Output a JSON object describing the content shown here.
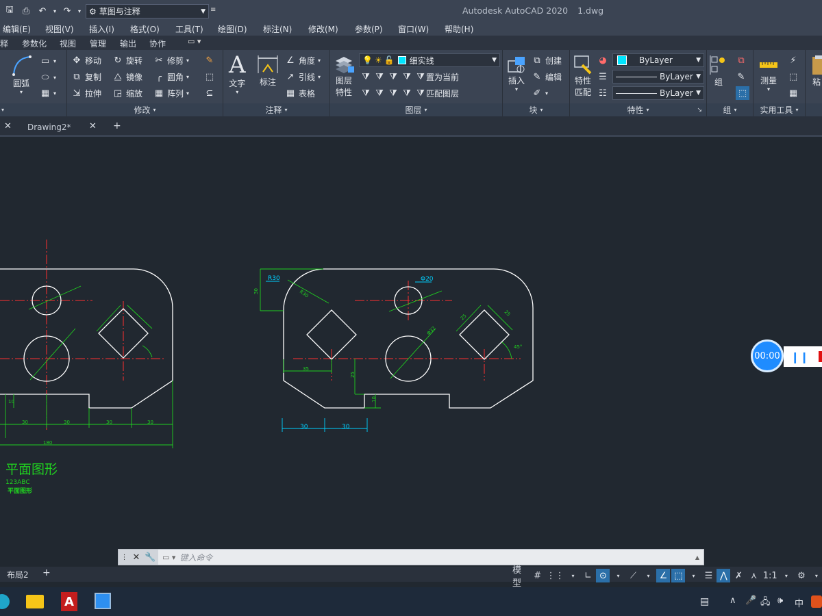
{
  "titlebar": {
    "workspace": "草图与注释",
    "app_title": "Autodesk AutoCAD 2020",
    "file_name": "1.dwg"
  },
  "menubar": {
    "items": [
      "编辑(E)",
      "视图(V)",
      "插入(I)",
      "格式(O)",
      "工具(T)",
      "绘图(D)",
      "标注(N)",
      "修改(M)",
      "参数(P)",
      "窗口(W)",
      "帮助(H)"
    ]
  },
  "ribbon_tabs": {
    "items": [
      "释",
      "参数化",
      "视图",
      "管理",
      "输出",
      "协作"
    ]
  },
  "ribbon": {
    "draw": {
      "arc": "圆弧"
    },
    "modify": {
      "title": "修改",
      "move": "移动",
      "rotate": "旋转",
      "trim": "修剪",
      "copy": "复制",
      "mirror": "镜像",
      "fillet": "圆角",
      "stretch": "拉伸",
      "scale": "缩放",
      "array": "阵列"
    },
    "annotation": {
      "title": "注释",
      "text": "文字",
      "dimension": "标注",
      "angular": "角度",
      "leader": "引线",
      "table": "表格"
    },
    "layers": {
      "title": "图层",
      "properties": "图层",
      "properties2": "特性",
      "current_layer": "细实线",
      "set_current": "置为当前",
      "match_layer": "匹配图层",
      "layer_color": "#00e5ff"
    },
    "block": {
      "title": "块",
      "insert": "插入",
      "create": "创建",
      "edit": "编辑"
    },
    "properties": {
      "title": "特性",
      "match": "特性",
      "match2": "匹配",
      "color": "ByLayer",
      "linetype": "ByLayer",
      "lineweight": "ByLayer"
    },
    "groups": {
      "title": "组",
      "group": "组"
    },
    "utilities": {
      "title": "实用工具",
      "measure": "测量"
    },
    "clipboard": {
      "paste": "粘"
    }
  },
  "doctabs": {
    "tab": "Drawing2*"
  },
  "drawing": {
    "left": {
      "title": "平面图形",
      "subtitle": "123ABC",
      "note": "平面图形",
      "dims": {
        "d1": "30",
        "d2": "30",
        "d3": "30",
        "d4": "30",
        "total": "180",
        "h": "10"
      }
    },
    "right": {
      "radius": "R30",
      "radius2": "R30",
      "phi_small": "Φ20",
      "phi_large": "Φ32",
      "height_left": "30",
      "sq1": "25",
      "sq2": "25",
      "angle": "45°",
      "h1": "35",
      "h2": "25",
      "h3": "10",
      "w1": "30",
      "w2": "30"
    }
  },
  "recorder": {
    "time": "00:00"
  },
  "cmdline": {
    "placeholder": "键入命令"
  },
  "layout_tabs": {
    "tab": "布局2"
  },
  "statusbar": {
    "model": "模型",
    "scale": "1:1"
  },
  "taskbar": {
    "ime": "中"
  }
}
